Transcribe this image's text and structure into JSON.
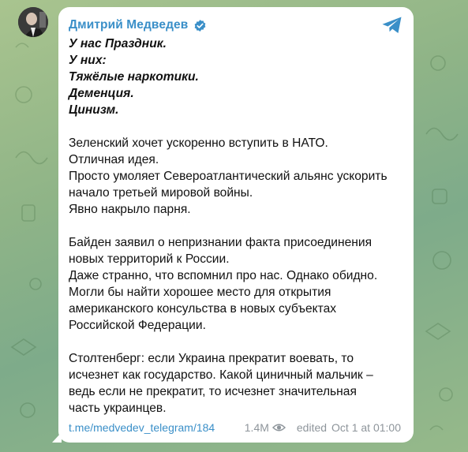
{
  "channel": {
    "name": "Дмитрий Медведев",
    "verified_color": "#3a8fc8",
    "accent": "#3a8fc8"
  },
  "post": {
    "italic_lines": [
      "У нас Праздник.",
      "У них:",
      "Тяжёлые наркотики.",
      "Деменция.",
      "Цинизм."
    ],
    "paragraph1": [
      "Зеленский хочет ускоренно вступить в НАТО.",
      "Отличная идея.",
      "Просто умоляет Североатлантический альянс ускорить",
      "начало третьей мировой войны.",
      "Явно накрыло парня."
    ],
    "paragraph2": [
      "Байден заявил о непризнании факта присоединения",
      "новых территорий к России.",
      "Даже странно, что вспомнил про нас. Однако обидно.",
      "Могли бы найти хорошее место для открытия",
      "американского консульства в новых субъектах",
      "Российской Федерации."
    ],
    "paragraph3": [
      "Столтенберг: если Украина прекратит воевать, то",
      "исчезнет как государство. Какой циничный мальчик –",
      "ведь если не прекратит, то исчезнет значительная",
      "часть украинцев."
    ]
  },
  "footer": {
    "link": "t.me/medvedev_telegram/184",
    "views": "1.4M",
    "views_icon": "eye-icon",
    "edited_label": "edited",
    "timestamp": "Oct 1 at 01:00"
  },
  "icons": {
    "share": "telegram-share-icon",
    "verified": "verified-badge-icon"
  }
}
